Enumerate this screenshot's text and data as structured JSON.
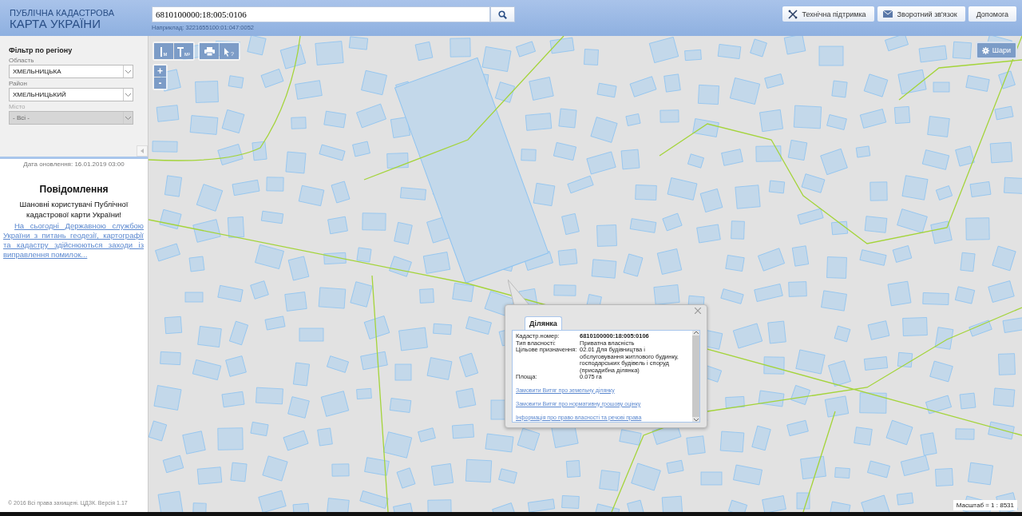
{
  "header": {
    "logo_line1": "ПУБЛІЧНА КАДАСТРОВА",
    "logo_line2": "КАРТА УКРАЇНИ",
    "search": {
      "value": "6810100000:18:005:0106",
      "hint": "Наприклад: 3221655100:01:047:0052"
    },
    "buttons": [
      {
        "kind": "support",
        "label": "Технічна підтримка"
      },
      {
        "kind": "feedback",
        "label": "Зворотний зв'язок"
      },
      {
        "kind": "help",
        "label": "Допомога"
      }
    ]
  },
  "filter": {
    "title": "Фільтр по регіону",
    "fields": [
      {
        "label": "Область",
        "value": "ХМЕЛЬНИЦЬКА",
        "disabled": false
      },
      {
        "label": "Район",
        "value": "ХМЕЛЬНИЦЬКИЙ",
        "disabled": false
      },
      {
        "label": "Місто",
        "value": "- Всі -",
        "disabled": true
      }
    ]
  },
  "update_date": "Дата оновлення: 16.01.2019 03:00",
  "notice": {
    "title": "Повідомлення",
    "greeting": "Шановні користувачі Публічної кадастрової карти України!",
    "link": "На сьогодні Державною службою України з питань геодезії, картографії та кадастру здійснюються заходи із виправлення помилок..."
  },
  "footer": "© 2016 Всі права захищені. ЦДЗК. Версія 1.17",
  "map": {
    "tools": [
      {
        "kind": "length",
        "unit": "м"
      },
      {
        "kind": "area",
        "unit": "м²"
      },
      {
        "kind": "print"
      },
      {
        "kind": "identify",
        "unit": "?"
      }
    ],
    "zoom": [
      "+",
      "-"
    ],
    "layers_button": "Шари",
    "scale": "Масштаб = 1 : 8531",
    "popup": {
      "tabs": [
        {
          "label": "Ділянка",
          "selected": true
        }
      ],
      "rows": [
        {
          "label": "Кадастр.номер:",
          "value": "6810100000:18:005:0106",
          "bold": true
        },
        {
          "label": "Тип власності:",
          "value": "Приватна власність",
          "bold": false
        },
        {
          "label": "Цільове призначення:",
          "value": "02.01 Для будівництва і обслуговування житлового будинку, господарських будівель і споруд (присадибна ділянка)",
          "bold": false
        },
        {
          "label": "Площа:",
          "value": "0.075 га",
          "bold": false
        }
      ],
      "links": [
        "Замовити Витяг про земельну ділянку",
        "Замовити Витяг про нормативну грошову оцінку",
        "Інформація про право власності та речові права"
      ]
    }
  }
}
